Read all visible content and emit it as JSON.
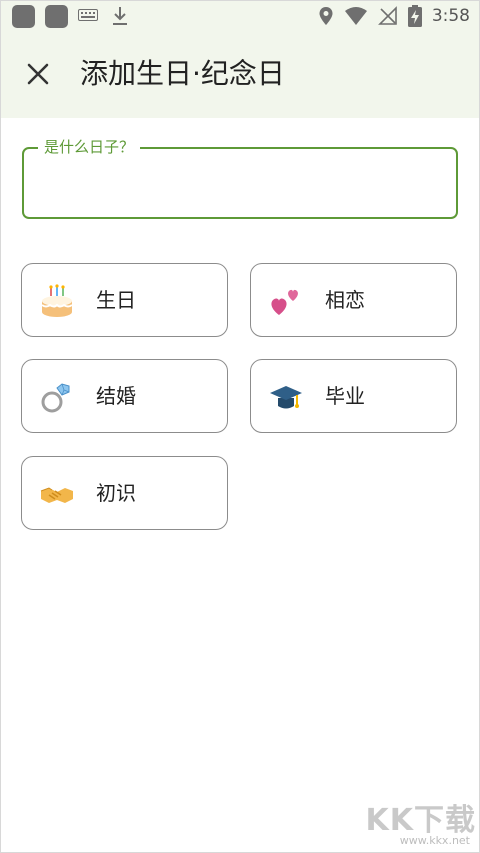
{
  "status_bar": {
    "time": "3:58"
  },
  "app_bar": {
    "title": "添加生日·纪念日"
  },
  "form": {
    "label": "是什么日子？",
    "value": "",
    "placeholder": ""
  },
  "options": [
    {
      "label": "生日",
      "icon": "birthday-cake-icon"
    },
    {
      "label": "相恋",
      "icon": "two-hearts-icon"
    },
    {
      "label": "结婚",
      "icon": "ring-icon"
    },
    {
      "label": "毕业",
      "icon": "graduation-cap-icon"
    },
    {
      "label": "初识",
      "icon": "handshake-icon"
    }
  ],
  "watermark": {
    "brand": "KK下载",
    "site": "www.kkx.net"
  },
  "colors": {
    "accent": "#5e9a37",
    "appbar_bg": "#f2f6ec",
    "card_border": "#8c8c8c"
  }
}
